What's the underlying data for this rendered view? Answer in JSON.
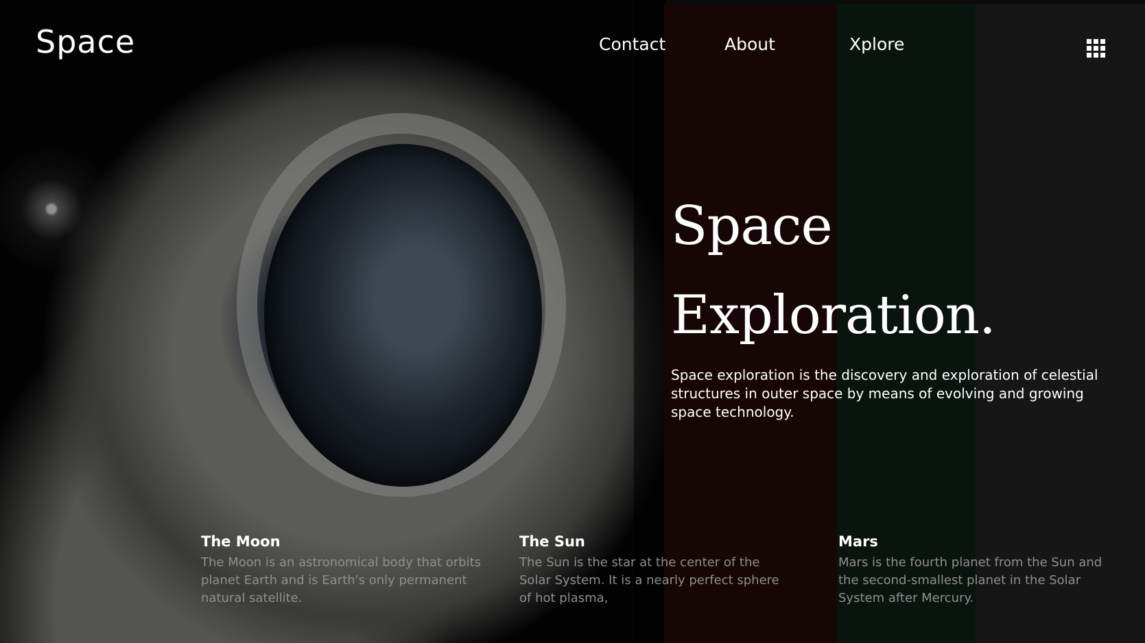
{
  "header": {
    "logo": "Space",
    "nav": [
      {
        "label": "Contact"
      },
      {
        "label": "About"
      },
      {
        "label": "Xplore"
      }
    ],
    "menu_icon": "grid-menu-icon"
  },
  "hero": {
    "title_line1": "Space",
    "title_line2": "Exploration.",
    "description": "Space exploration is the discovery and exploration of celestial structures in outer space by means of evolving and growing space technology."
  },
  "cards": [
    {
      "title": "The Moon",
      "text": "The Moon is an astronomical body that orbits planet Earth and is Earth's only permanent natural satellite."
    },
    {
      "title": "The Sun",
      "text": "The Sun is the star at the center of the Solar System. It is a nearly perfect sphere of hot plasma,"
    },
    {
      "title": "Mars",
      "text": "Mars is the fourth planet from the Sun and the second-smallest planet in the Solar System after Mercury."
    }
  ],
  "colors": {
    "band_red": "#170606",
    "band_green": "#0a140f",
    "band_gray": "#161616",
    "muted_text": "#8f8f8f"
  }
}
